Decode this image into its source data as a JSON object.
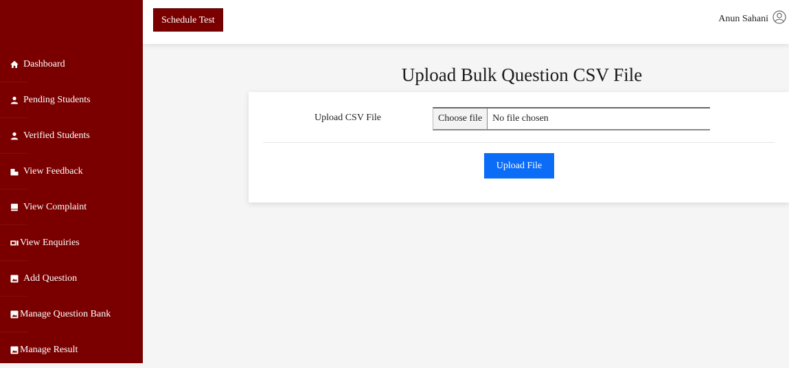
{
  "header": {
    "schedule_label": "Schedule Test",
    "user_name": "Anun Sahani"
  },
  "sidebar": {
    "items": [
      {
        "label": "Dashboard",
        "icon": "home-icon"
      },
      {
        "label": "Pending Students",
        "icon": "user-icon"
      },
      {
        "label": "Verified Students",
        "icon": "user-icon"
      },
      {
        "label": "View Feedback",
        "icon": "feedback-icon"
      },
      {
        "label": "View Complaint",
        "icon": "document-icon"
      },
      {
        "label": "View Enquiries",
        "icon": "video-icon"
      },
      {
        "label": "Add Question",
        "icon": "image-icon"
      },
      {
        "label": "Manage Question Bank",
        "icon": "image-icon"
      },
      {
        "label": "Manage Result",
        "icon": "image-icon"
      }
    ]
  },
  "main": {
    "title": "Upload Bulk Question CSV File",
    "field_label": "Upload CSV File",
    "choose_label": "Choose file",
    "file_status": "No file chosen",
    "upload_label": "Upload File"
  },
  "colors": {
    "sidebar": "#7a0000",
    "primary_button": "#0b6cf7"
  }
}
